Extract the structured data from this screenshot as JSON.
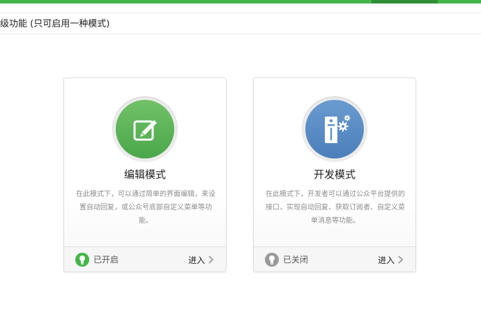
{
  "page": {
    "section_title": "级功能 (只可启用一种模式)"
  },
  "modes": [
    {
      "title": "编辑模式",
      "description": "在此模式下，可以通过简单的界面编辑，来设置自动回复，或公众号底部自定义菜单等功能。",
      "status_label": "已开启",
      "status": "on",
      "enter_label": "进入",
      "icon": "edit-icon",
      "accent_color": "#5cb85c"
    },
    {
      "title": "开发模式",
      "description": "在此模式下，开发者可以通过公众平台提供的接口，实现自动回复、获取订阅者、自定义菜单消息等功能。",
      "status_label": "已关闭",
      "status": "off",
      "enter_label": "进入",
      "icon": "server-gear-icon",
      "accent_color": "#5b8fc7"
    }
  ],
  "colors": {
    "accent_green": "#44b549",
    "status_off": "#9a9a9a"
  }
}
